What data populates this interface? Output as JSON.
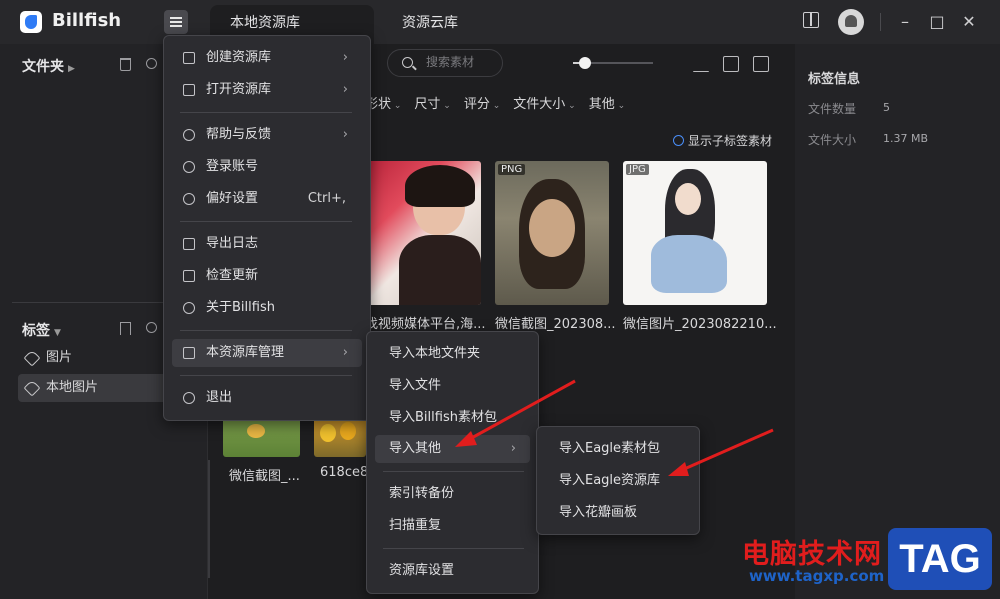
{
  "app": {
    "name": "Billfish"
  },
  "tabs": [
    {
      "label": "本地资源库"
    },
    {
      "label": "资源云库"
    }
  ],
  "sidebar": {
    "folders_title": "文件夹",
    "tags_title": "标签",
    "tags": [
      {
        "label": "图片"
      },
      {
        "label": "本地图片"
      }
    ]
  },
  "toolbar": {
    "search_placeholder": "搜索素材",
    "zoom_level": 0.15,
    "filters": [
      "形状",
      "尺寸",
      "评分",
      "文件大小",
      "其他"
    ],
    "show_sub_tags": "显示子标签素材"
  },
  "assets": [
    {
      "name": "找视频媒体平台,海...",
      "format": ""
    },
    {
      "name": "微信截图_202308...",
      "format": "PNG"
    },
    {
      "name": "微信图片_2023082210...",
      "format": "JPG"
    },
    {
      "name": "微信截图_...",
      "format": ""
    },
    {
      "name": "618ce8",
      "format": ""
    }
  ],
  "info_panel": {
    "title": "标签信息",
    "file_count_label": "文件数量",
    "file_count": "5",
    "file_size_label": "文件大小",
    "file_size": "1.37 MB"
  },
  "main_menu": {
    "create_library": "创建资源库",
    "open_library": "打开资源库",
    "help": "帮助与反馈",
    "login": "登录账号",
    "preferences": "偏好设置",
    "preferences_shortcut": "Ctrl+,",
    "export_log": "导出日志",
    "check_update": "检查更新",
    "about": "关于Billfish",
    "library_manage": "本资源库管理",
    "exit": "退出"
  },
  "library_menu": {
    "import_folder": "导入本地文件夹",
    "import_file": "导入文件",
    "import_pack": "导入Billfish素材包",
    "import_other": "导入其他",
    "index_backup": "索引转备份",
    "scan_duplicates": "扫描重复",
    "library_settings": "资源库设置"
  },
  "import_other_menu": {
    "eagle_pack": "导入Eagle素材包",
    "eagle_library": "导入Eagle资源库",
    "huaban": "导入花瓣画板"
  },
  "watermark": {
    "site_cn": "电脑技术网",
    "url": "www.tagxp.com",
    "tag": "TAG"
  },
  "colors": {
    "accent": "#2f7bf5",
    "arrow": "#e11d1d",
    "background": "#1e1e20"
  }
}
